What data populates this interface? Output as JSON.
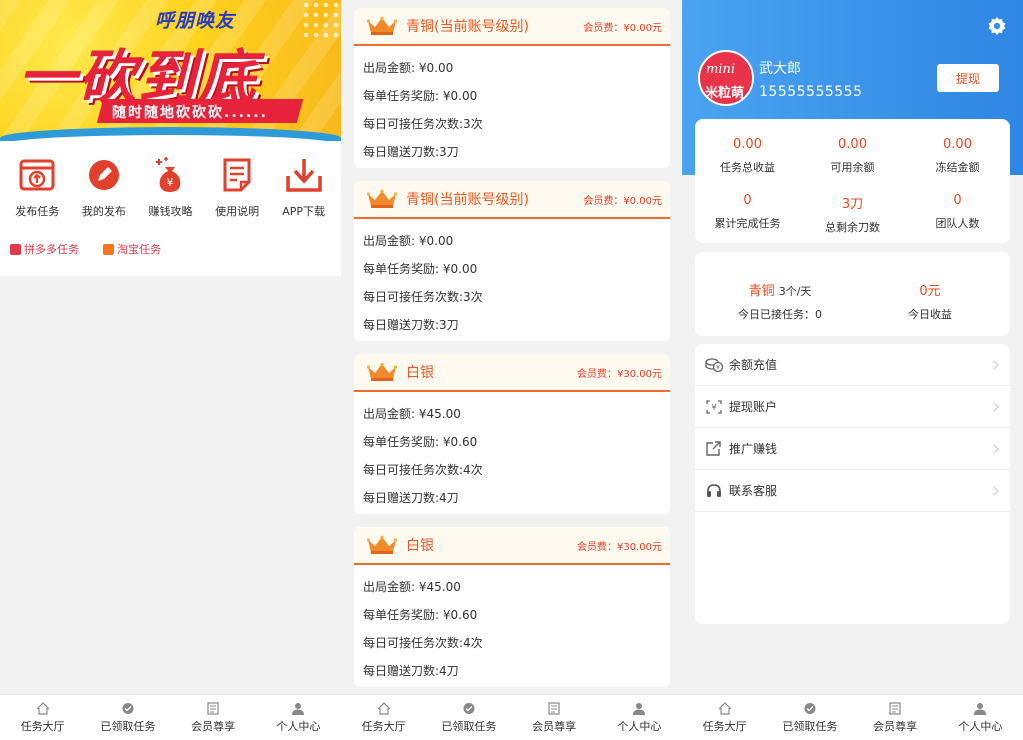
{
  "panel1": {
    "banner": {
      "top_text": "呼朋唤友",
      "main_text": "一砍到底",
      "sub_text": "随时随地砍砍砍......"
    },
    "menu": [
      {
        "label": "发布任务",
        "icon": "publish-task-icon"
      },
      {
        "label": "我的发布",
        "icon": "my-publish-icon"
      },
      {
        "label": "赚钱攻略",
        "icon": "money-bag-icon"
      },
      {
        "label": "使用说明",
        "icon": "document-icon"
      },
      {
        "label": "APP下载",
        "icon": "download-icon"
      }
    ],
    "tags": [
      {
        "label": "拼多多任务",
        "icon": "pinduoduo-icon"
      },
      {
        "label": "淘宝任务",
        "icon": "taobao-icon"
      }
    ]
  },
  "panel2": {
    "cards": [
      {
        "title": "青铜(当前账号级别)",
        "fee": "会员费：¥0.00元",
        "lines": [
          "出局金额: ¥0.00",
          "每单任务奖励: ¥0.00",
          "每日可接任务次数:3次",
          "每日赠送刀数:3刀"
        ]
      },
      {
        "title": "青铜(当前账号级别)",
        "fee": "会员费：¥0.00元",
        "lines": [
          "出局金额: ¥0.00",
          "每单任务奖励: ¥0.00",
          "每日可接任务次数:3次",
          "每日赠送刀数:3刀"
        ]
      },
      {
        "title": "白银",
        "fee": "会员费：¥30.00元",
        "lines": [
          "出局金额: ¥45.00",
          "每单任务奖励: ¥0.60",
          "每日可接任务次数:4次",
          "每日赠送刀数:4刀"
        ]
      },
      {
        "title": "白银",
        "fee": "会员费：¥30.00元",
        "lines": [
          "出局金额: ¥45.00",
          "每单任务奖励: ¥0.60",
          "每日可接任务次数:4次",
          "每日赠送刀数:4刀"
        ]
      }
    ]
  },
  "panel3": {
    "avatar": {
      "line1": "mini",
      "line2": "米粒萌"
    },
    "user": {
      "name": "武大郎",
      "phone": "15555555555"
    },
    "withdraw_label": "提现",
    "stats": [
      {
        "value": "0.00",
        "label": "任务总收益"
      },
      {
        "value": "0.00",
        "label": "可用余额"
      },
      {
        "value": "0.00",
        "label": "冻结金额"
      },
      {
        "value": "0",
        "label": "累计完成任务"
      },
      {
        "value": "3刀",
        "label": "总剩余刀数"
      },
      {
        "value": "0",
        "label": "团队人数"
      }
    ],
    "level": {
      "name": "青铜",
      "per_day": "3个/天",
      "accepted_today": "今日已接任务：0",
      "income_value": "0元",
      "income_label": "今日收益"
    },
    "list": [
      {
        "label": "余额充值",
        "icon": "coins-icon"
      },
      {
        "label": "提现账户",
        "icon": "withdraw-account-icon"
      },
      {
        "label": "推广赚钱",
        "icon": "share-icon"
      },
      {
        "label": "联系客服",
        "icon": "headset-icon"
      }
    ]
  },
  "bottom_nav": [
    {
      "label": "任务大厅",
      "icon": "home-icon"
    },
    {
      "label": "已领取任务",
      "icon": "tasks-icon"
    },
    {
      "label": "会员尊享",
      "icon": "member-icon"
    },
    {
      "label": "个人中心",
      "icon": "user-icon"
    }
  ],
  "colors": {
    "accent": "#ec4a22",
    "blue": "#2f86e4",
    "banner": "#ffd21e",
    "red": "#e6233b"
  }
}
